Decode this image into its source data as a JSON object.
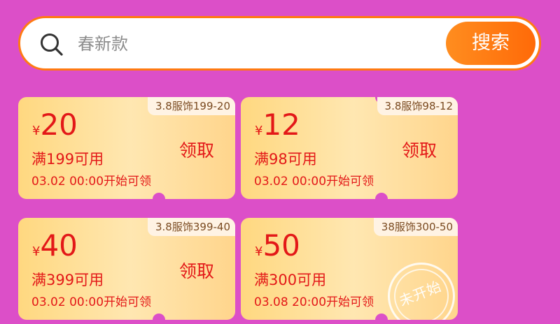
{
  "search": {
    "placeholder": "春新款",
    "button_label": "搜索"
  },
  "coupons": [
    {
      "tag": "3.8服饰199-20",
      "currency": "¥",
      "amount": "20",
      "threshold": "满199可用",
      "time": "03.02 00:00开始可领",
      "action": "领取"
    },
    {
      "tag": "3.8服饰98-12",
      "currency": "¥",
      "amount": "12",
      "threshold": "满98可用",
      "time": "03.02 00:00开始可领",
      "action": "领取"
    },
    {
      "tag": "3.8服饰399-40",
      "currency": "¥",
      "amount": "40",
      "threshold": "满399可用",
      "time": "03.02 00:00开始可领",
      "action": "领取"
    },
    {
      "tag": "38服饰300-50",
      "currency": "¥",
      "amount": "50",
      "threshold": "满300可用",
      "time": "03.08 20:00开始可领",
      "stamp": "未开始"
    }
  ],
  "colors": {
    "background": "#dc4fc8",
    "accent": "#ff7a12",
    "price_red": "#e31818",
    "coupon_bg": "#ffe7b1"
  }
}
